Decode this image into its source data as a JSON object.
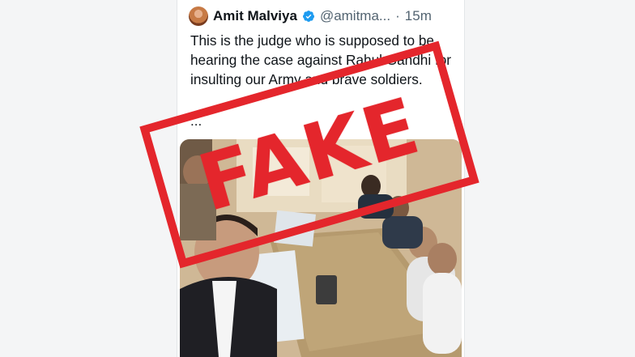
{
  "post": {
    "author_name": "Amit Malviya",
    "author_handle": "@amitma...",
    "separator": "·",
    "timestamp": "15m",
    "text": "This is the judge who is supposed to be hearing the case against Rahul Gandhi for insulting our Army and brave soldiers.",
    "truncation": "...",
    "verified_icon": "verified-badge-icon",
    "avatar_icon": "avatar"
  },
  "overlay": {
    "stamp_text": "FAKE",
    "stamp_color": "#e4262c"
  },
  "colors": {
    "verified": "#1d9bf0",
    "text": "#0f1419",
    "muted": "#536471"
  }
}
